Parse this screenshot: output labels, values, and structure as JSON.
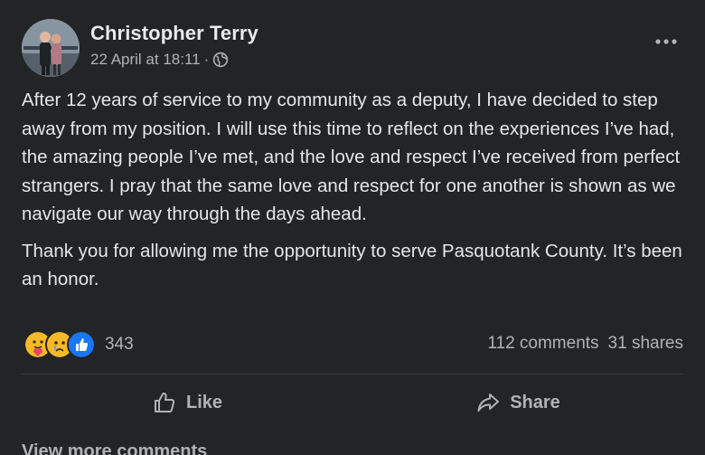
{
  "post": {
    "author": "Christopher Terry",
    "timestamp": "22 April at 18:11",
    "separator": "·",
    "audience_icon": "globe-icon",
    "more_icon": "more-options-icon",
    "paragraphs": [
      "After 12 years of service to my community as a deputy, I have decided to step away from my position. I will use this time to reflect on the experiences I’ve had, the amazing people I’ve met, and the love and respect I’ve received from perfect strangers. I pray that the same love and respect for one another is shown as we navigate our way through the days ahead.",
      "Thank you for allowing me the opportunity to serve Pasquotank County. It’s been an honor."
    ]
  },
  "engagement": {
    "reaction_icons": [
      "care-reaction-icon",
      "sad-reaction-icon",
      "like-reaction-icon"
    ],
    "reaction_count": "343",
    "comments": "112 comments",
    "shares": "31 shares"
  },
  "actions": {
    "like_label": "Like",
    "share_label": "Share"
  },
  "footer": {
    "view_more": "View more comments"
  },
  "colors": {
    "background": "#232425",
    "text_primary": "#e4e6eb",
    "text_secondary": "#b0b3b8",
    "like_blue": "#1877f2",
    "reaction_yellow": "#f7b928"
  }
}
